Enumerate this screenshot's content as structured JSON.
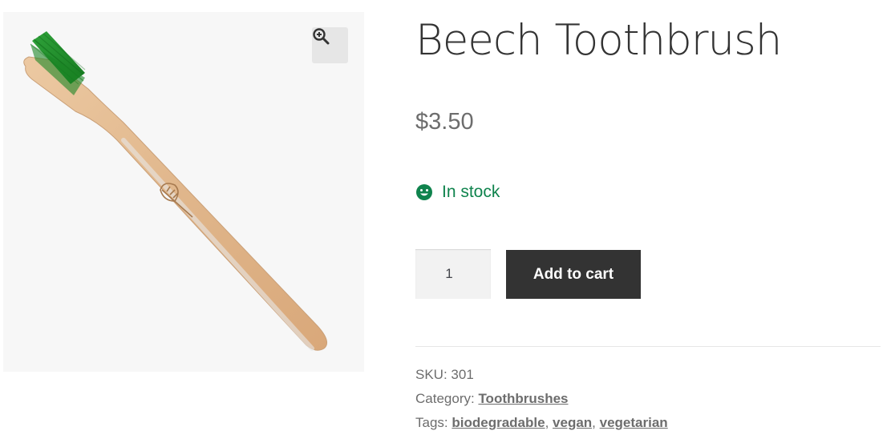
{
  "product": {
    "title": "Beech Toothbrush",
    "price": "$3.50",
    "stock": "In stock",
    "image_alt": "Beech Toothbrush"
  },
  "purchase": {
    "quantity": "1",
    "add_to_cart_label": "Add to cart"
  },
  "meta": {
    "sku_label": "SKU:",
    "sku_value": "301",
    "category_label": "Category:",
    "category_link": "Toothbrushes",
    "tags_label": "Tags:",
    "tags": [
      "biodegradable",
      "vegan",
      "vegetarian"
    ],
    "tag_separator": ","
  },
  "icons": {
    "zoom": "zoom-in-icon",
    "stock": "smiley-icon",
    "engraving": "leaf-icon"
  },
  "colors": {
    "stock_green": "#0f834d",
    "button_dark": "#333333",
    "bristles_green": "#1f8f2a",
    "handle_wood": "#e2b98f"
  }
}
